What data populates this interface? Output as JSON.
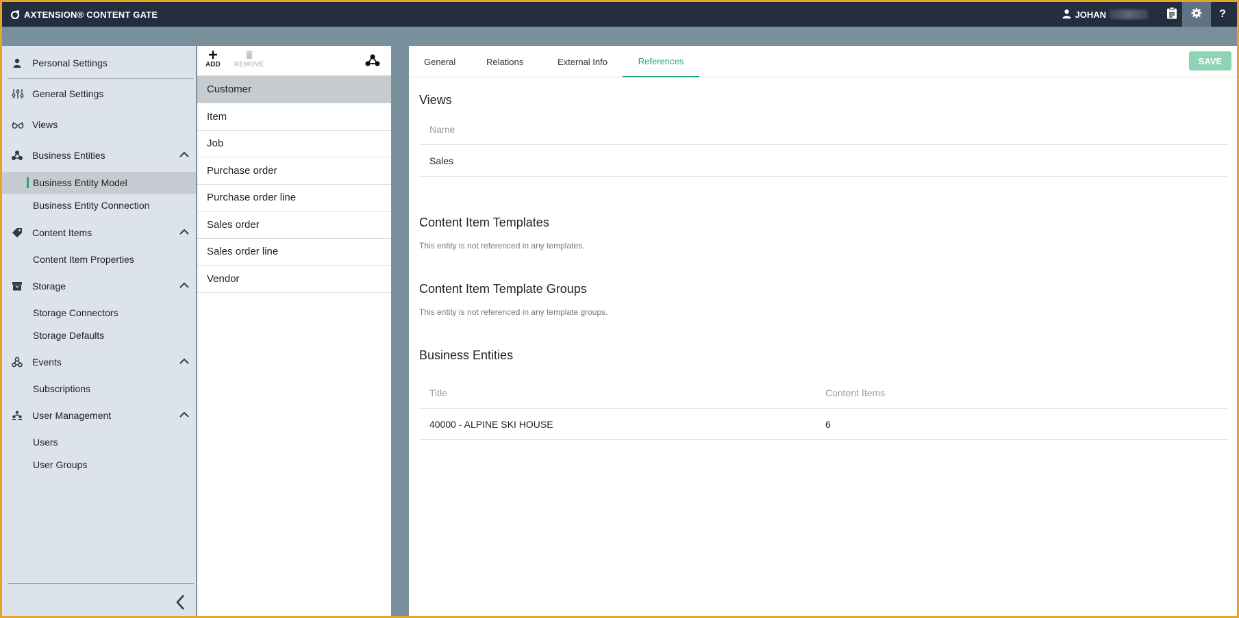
{
  "app": {
    "title": "AXTENSION® CONTENT GATE",
    "user_name": "JOHAN",
    "help_label": "?"
  },
  "sidebar": {
    "items": [
      {
        "label": "Personal Settings",
        "icon": "person-icon"
      },
      {
        "label": "General Settings",
        "icon": "sliders-icon"
      },
      {
        "label": "Views",
        "icon": "glasses-icon"
      },
      {
        "label": "Business Entities",
        "icon": "entities-icon",
        "expanded": true,
        "children": [
          {
            "label": "Business Entity Model",
            "active": true
          },
          {
            "label": "Business Entity Connection"
          }
        ]
      },
      {
        "label": "Content Items",
        "icon": "tag-icon",
        "expanded": true,
        "children": [
          {
            "label": "Content Item Properties"
          }
        ]
      },
      {
        "label": "Storage",
        "icon": "archive-icon",
        "expanded": true,
        "children": [
          {
            "label": "Storage Connectors"
          },
          {
            "label": "Storage Defaults"
          }
        ]
      },
      {
        "label": "Events",
        "icon": "webhook-icon",
        "expanded": true,
        "children": [
          {
            "label": "Subscriptions"
          }
        ]
      },
      {
        "label": "User Management",
        "icon": "users-icon",
        "expanded": true,
        "children": [
          {
            "label": "Users"
          },
          {
            "label": "User Groups"
          }
        ]
      }
    ]
  },
  "entity_list": {
    "add_label": "ADD",
    "remove_label": "REMOVE",
    "items": [
      "Customer",
      "Item",
      "Job",
      "Purchase order",
      "Purchase order line",
      "Sales order",
      "Sales order line",
      "Vendor"
    ],
    "selected": "Customer"
  },
  "detail": {
    "tabs": [
      "General",
      "Relations",
      "External Info",
      "References"
    ],
    "active_tab": "References",
    "save_label": "SAVE",
    "views": {
      "title": "Views",
      "column_name": "Name",
      "rows": [
        "Sales"
      ]
    },
    "templates": {
      "title": "Content Item Templates",
      "note": "This entity is not referenced in any templates."
    },
    "template_groups": {
      "title": "Content Item Template Groups",
      "note": "This entity is not referenced in any template groups."
    },
    "business_entities": {
      "title": "Business Entities",
      "columns": [
        "Title",
        "Content Items"
      ],
      "rows": [
        {
          "title": "40000 - ALPINE SKI HOUSE",
          "content_items": "6"
        }
      ]
    }
  },
  "colors": {
    "accent": "#1fa67a",
    "topbar": "#232f3e",
    "sidebar": "#dde3ea",
    "save_button": "#8ed3b5"
  }
}
